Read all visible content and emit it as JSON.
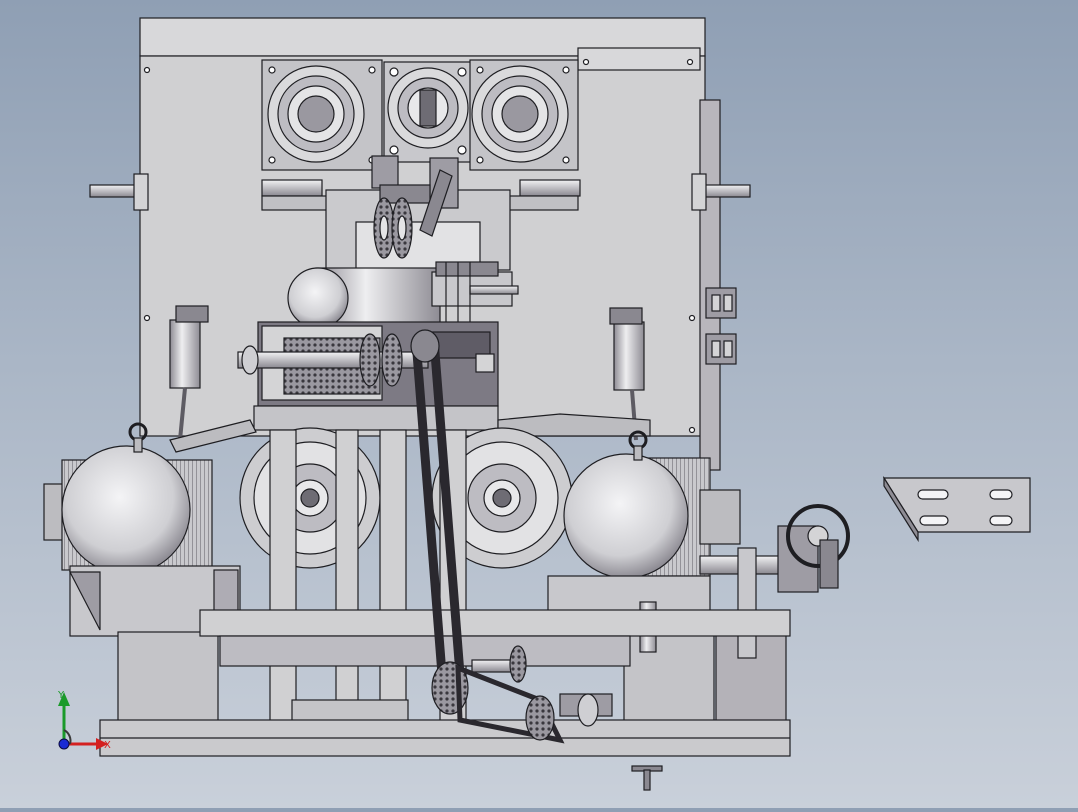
{
  "viewport": {
    "background_top": "#8f9fb4",
    "background_bottom": "#c9d0da",
    "part_fill": "#d4d4d6",
    "part_shadow": "#8d8a92",
    "outline": "#1e1e22"
  },
  "triad": {
    "x_label": "X",
    "y_label": "Y",
    "x_color": "#d42020",
    "y_color": "#1a9a2a",
    "z_color": "#1a2ad4"
  }
}
